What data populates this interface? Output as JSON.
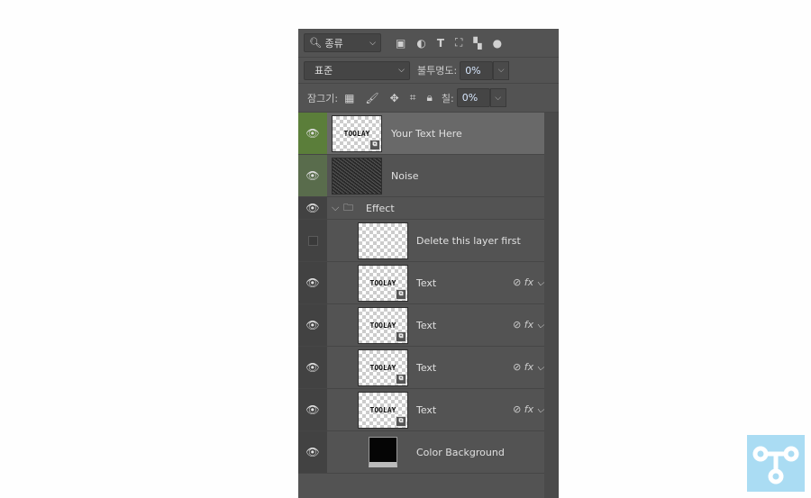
{
  "toolbar": {
    "filter_label": "종류",
    "filter_icons": [
      "image-filter-icon",
      "adjustment-filter-icon",
      "type-filter-icon",
      "shape-filter-icon",
      "smart-object-filter-icon",
      "filter-toggle-icon"
    ]
  },
  "blend": {
    "mode": "표준",
    "opacity_label": "불투명도:",
    "opacity": "0%"
  },
  "lock": {
    "label": "잠그기:",
    "icons": [
      "lock-transparent-icon",
      "lock-image-icon",
      "lock-position-icon",
      "lock-artboard-icon",
      "lock-all-icon"
    ],
    "fill_label": "칠:",
    "fill": "0%"
  },
  "layers": [
    {
      "name": "Your Text Here",
      "type": "smart",
      "thumb": "TOOLAY",
      "visible": true,
      "selected": true,
      "indent": 0
    },
    {
      "name": "Noise",
      "type": "noise",
      "visible": true,
      "indent": 0
    },
    {
      "name": "Effect",
      "type": "group",
      "visible": true,
      "indent": 0
    },
    {
      "name": "Delete this layer first",
      "type": "image",
      "visible": false,
      "indent": 1
    },
    {
      "name": "Text",
      "type": "smart",
      "thumb": "TOOLAY",
      "visible": true,
      "indent": 1,
      "fx": true
    },
    {
      "name": "Text",
      "type": "smart",
      "thumb": "TOOLAY",
      "visible": true,
      "indent": 1,
      "fx": true
    },
    {
      "name": "Text",
      "type": "smart",
      "thumb": "TOOLAY",
      "visible": true,
      "indent": 1,
      "fx": true
    },
    {
      "name": "Text",
      "type": "smart",
      "thumb": "TOOLAY",
      "visible": true,
      "indent": 1,
      "fx": true
    },
    {
      "name": "Color Background",
      "type": "fill",
      "visible": true,
      "indent": 1
    }
  ],
  "colors": {
    "selected_eye": "#5b7e3a",
    "panel": "#535353",
    "logo": "#aadcf3"
  }
}
